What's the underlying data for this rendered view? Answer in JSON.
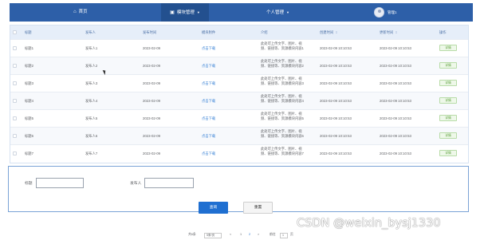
{
  "nav": {
    "home_icon": "home-icon",
    "home": "首页",
    "module_icon": "module-icon",
    "module": "模块管理",
    "personal": "个人管理",
    "user": "管理1"
  },
  "table": {
    "headers": {
      "title": "标题",
      "publisher": "发布人",
      "publish_time": "发布时间",
      "attachment": "模块附件",
      "description": "介绍",
      "created_time": "创建时间",
      "updated_time": "更新时间",
      "action": "操作"
    },
    "rows": [
      {
        "title": "标题1",
        "publisher": "发布人1",
        "publish_time": "2023-02-09",
        "attachment": "点击下载",
        "description": "此处可上传文字、图片、视频、链接等、资源模块内容1",
        "created_time": "2023-02-09 10:10:53",
        "updated_time": "2023-02-09 10:10:53",
        "action": "详情"
      },
      {
        "title": "标题2",
        "publisher": "发布人2",
        "publish_time": "2023-02-09",
        "attachment": "点击下载",
        "description": "此处可上传文字、图片、视频、链接等、资源模块内容2",
        "created_time": "2023-02-09 10:10:53",
        "updated_time": "2023-02-09 10:10:53",
        "action": "详情"
      },
      {
        "title": "标题3",
        "publisher": "发布人3",
        "publish_time": "2023-02-09",
        "attachment": "点击下载",
        "description": "此处可上传文字、图片、视频、链接等、资源模块内容3",
        "created_time": "2023-02-09 10:10:53",
        "updated_time": "2023-02-09 10:10:53",
        "action": "详情"
      },
      {
        "title": "标题4",
        "publisher": "发布人4",
        "publish_time": "2023-02-09",
        "attachment": "点击下载",
        "description": "此处可上传文字、图片、视频、链接等、资源模块内容4",
        "created_time": "2023-02-09 10:10:53",
        "updated_time": "2023-02-09 10:10:53",
        "action": "详情"
      },
      {
        "title": "标题5",
        "publisher": "发布人5",
        "publish_time": "2023-02-09",
        "attachment": "点击下载",
        "description": "此处可上传文字、图片、视频、链接等、资源模块内容5",
        "created_time": "2023-02-09 10:10:53",
        "updated_time": "2023-02-09 10:10:53",
        "action": "详情"
      },
      {
        "title": "标题6",
        "publisher": "发布人6",
        "publish_time": "2023-02-09",
        "attachment": "点击下载",
        "description": "此处可上传文字、图片、视频、链接等、资源模块内容6",
        "created_time": "2023-02-09 10:10:53",
        "updated_time": "2023-02-09 10:10:53",
        "action": "详情"
      },
      {
        "title": "标题7",
        "publisher": "发布人7",
        "publish_time": "2023-02-09",
        "attachment": "点击下载",
        "description": "此处可上传文字、图片、视频、链接等、资源模块内容7",
        "created_time": "2023-02-09 10:10:53",
        "updated_time": "2023-02-09 10:10:53",
        "action": "详情"
      }
    ]
  },
  "search": {
    "title_label": "标题",
    "title_value": "",
    "publisher_label": "发布人",
    "publisher_value": "",
    "query_button": "查询",
    "reset_button": "重置"
  },
  "pagination": {
    "total": "共6条",
    "page_size": "5条/页",
    "prev": "<",
    "pages": [
      "1",
      "2"
    ],
    "next": ">",
    "goto_label": "前往",
    "goto_value": "1",
    "page_suffix": "页"
  },
  "watermark": "CSDN @weixin_bysj1330",
  "colors": {
    "nav_bg": "#2d5fa8",
    "header_bg": "#e6eef9",
    "link": "#3c84d6",
    "detail_green": "#5da03c",
    "primary": "#1f6fd1"
  }
}
